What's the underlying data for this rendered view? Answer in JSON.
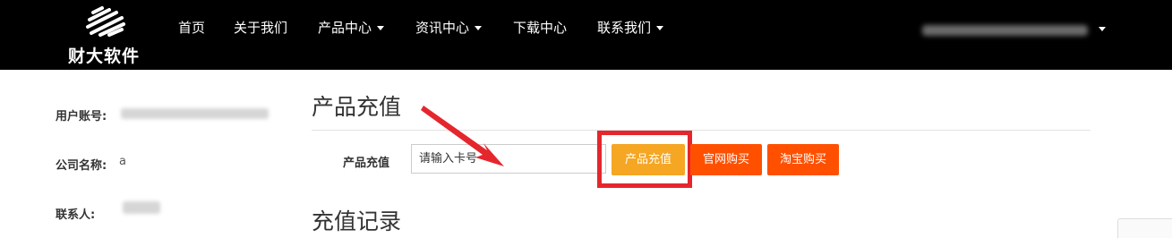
{
  "brand": {
    "name": "财大软件",
    "logo_icon": "caida-logo-icon"
  },
  "nav": {
    "items": [
      {
        "label": "首页"
      },
      {
        "label": "关于我们"
      },
      {
        "label": "产品中心",
        "dropdown": true
      },
      {
        "label": "资讯中心",
        "dropdown": true
      },
      {
        "label": "下载中心"
      },
      {
        "label": "联系我们",
        "dropdown": true
      }
    ],
    "user_menu_icon": "chevron-down-icon"
  },
  "sidebar": {
    "account_label": "用户账号:",
    "company_label": "公司名称:",
    "company_value": "a",
    "contact_label": "联系人:"
  },
  "recharge": {
    "title": "产品充值",
    "form_label": "产品充值",
    "input_placeholder": "请输入卡号",
    "recharge_button": "产品充值",
    "official_buy_button": "官网购买",
    "taobao_buy_button": "淘宝购买"
  },
  "history": {
    "title": "充值记录"
  },
  "colors": {
    "navbar_bg": "#000000",
    "recharge_button": "#f5a623",
    "buy_button": "#ff5000",
    "highlight": "#e5262d"
  }
}
